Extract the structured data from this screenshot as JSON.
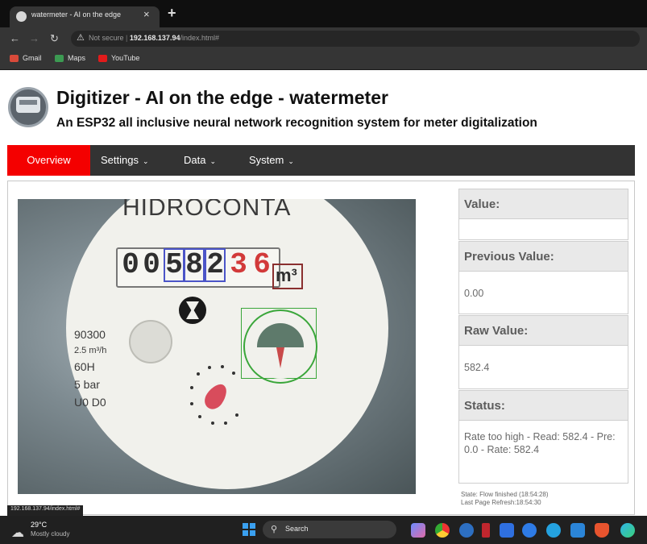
{
  "browser": {
    "tab_title": "watermeter - AI on the edge",
    "tab_close": "×",
    "new_tab": "+",
    "nav_back": "←",
    "nav_forward": "→",
    "nav_reload": "↻",
    "security_label": "Not secure",
    "url_host": "192.168.137.94",
    "url_path": "/index.html#",
    "bookmarks": [
      "Gmail",
      "Maps",
      "YouTube"
    ],
    "status_url": "192.168.137.94/index.html#"
  },
  "page": {
    "title": "Digitizer - AI on the edge - watermeter",
    "subtitle": "An ESP32 all inclusive neural network recognition system for meter digitalization"
  },
  "menu": {
    "overview": "Overview",
    "settings": "Settings",
    "data": "Data",
    "system": "System",
    "chevron": "⌄"
  },
  "meter_image": {
    "brand": "HIDROCONTA",
    "digits": [
      "0",
      "0",
      "5",
      "8",
      "2"
    ],
    "decimal_digits": [
      "3",
      "6"
    ],
    "unit": "m³",
    "spec_lines": [
      "90300",
      "2.5 m³/h",
      "60H",
      "5 bar",
      "U0 D0"
    ]
  },
  "panel": {
    "value_label": "Value:",
    "value": "",
    "previous_label": "Previous Value:",
    "previous_value": "0.00",
    "raw_label": "Raw Value:",
    "raw_value": "582.4",
    "status_label": "Status:",
    "status_value": "Rate too high - Read: 582.4 - Pre: 0.0 - Rate: 582.4",
    "footer_state": "State: Flow finished (18:54:28)",
    "footer_refresh": "Last Page Refresh:18:54:30"
  },
  "taskbar": {
    "temperature": "29°C",
    "weather": "Mostly cloudy",
    "search_placeholder": "Search"
  }
}
